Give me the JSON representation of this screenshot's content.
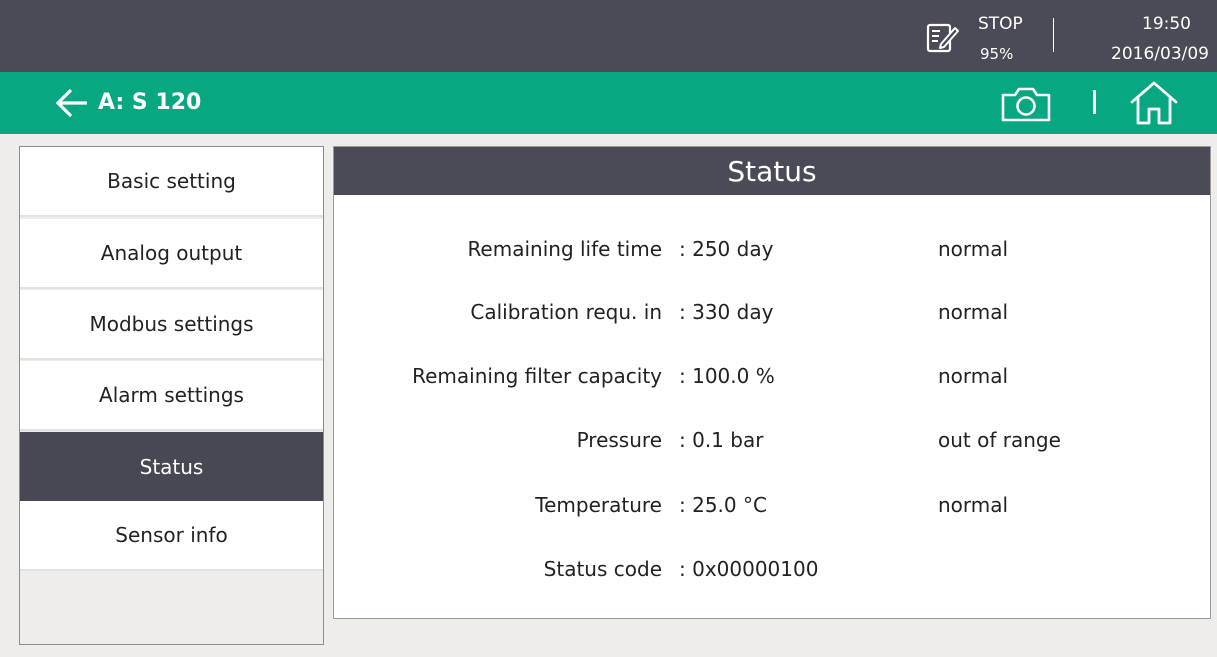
{
  "topbar": {
    "run_state": "STOP",
    "disk_usage": "95%",
    "time": "19:50",
    "date": "2016/03/09",
    "icons": [
      "record-edit-icon"
    ]
  },
  "header": {
    "title": "A: S 120",
    "icons": [
      "back-arrow-icon",
      "camera-icon",
      "home-icon"
    ],
    "color": "#07a781"
  },
  "sidebar": {
    "items": [
      {
        "label": "Basic setting",
        "active": false
      },
      {
        "label": "Analog output",
        "active": false
      },
      {
        "label": "Modbus settings",
        "active": false
      },
      {
        "label": "Alarm settings",
        "active": false
      },
      {
        "label": "Status",
        "active": true
      },
      {
        "label": "Sensor info",
        "active": false
      }
    ]
  },
  "panel": {
    "title": "Status",
    "rows": [
      {
        "label": "Remaining life time",
        "value": ": 250 day",
        "state": "normal"
      },
      {
        "label": "Calibration requ. in",
        "value": ": 330 day",
        "state": "normal"
      },
      {
        "label": "Remaining filter capacity",
        "value": ": 100.0 %",
        "state": "normal"
      },
      {
        "label": "Pressure",
        "value": ": 0.1 bar",
        "state": "out of range"
      },
      {
        "label": "Temperature",
        "value": ": 25.0 °C",
        "state": "normal"
      },
      {
        "label": "Status code",
        "value": ": 0x00000100",
        "state": ""
      }
    ]
  },
  "colors": {
    "dark_bar": "#4a4b56",
    "accent": "#07a781",
    "background": "#efedea"
  }
}
